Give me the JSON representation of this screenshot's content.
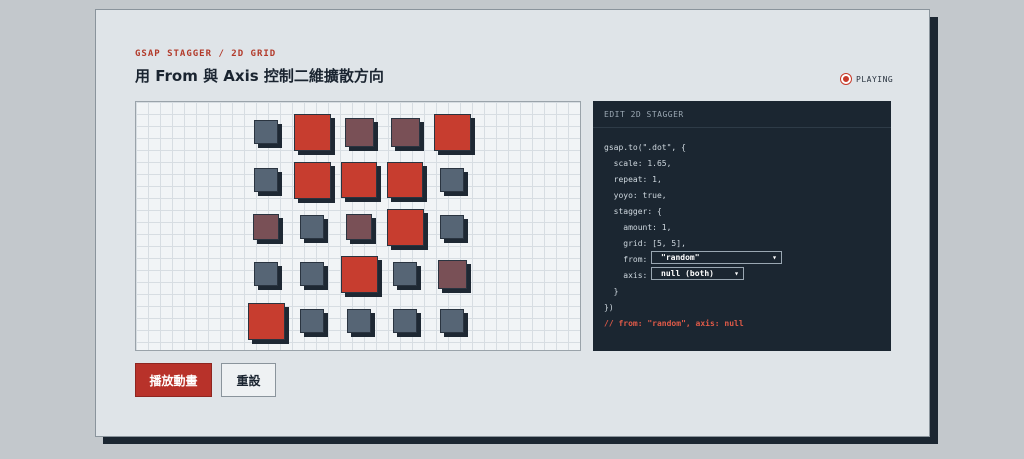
{
  "header": {
    "eyebrow": "GSAP STAGGER / 2D GRID",
    "title": "用 From 與 Axis 控制二維擴散方向",
    "status": "PLAYING"
  },
  "colors": {
    "accent": "#b8322a",
    "red": "#c73d2f",
    "slate": "#566575",
    "mauve": "#795056",
    "dark_panel": "#1b2631"
  },
  "stage": {
    "grid_rows": 5,
    "grid_cols": 5,
    "dots": [
      {
        "row": 0,
        "col": 0,
        "scale": 0.55,
        "color": "slate"
      },
      {
        "row": 0,
        "col": 1,
        "scale": 0.85,
        "color": "red"
      },
      {
        "row": 0,
        "col": 2,
        "scale": 0.65,
        "color": "mauve"
      },
      {
        "row": 0,
        "col": 3,
        "scale": 0.65,
        "color": "mauve"
      },
      {
        "row": 0,
        "col": 4,
        "scale": 0.85,
        "color": "red"
      },
      {
        "row": 1,
        "col": 0,
        "scale": 0.55,
        "color": "slate"
      },
      {
        "row": 1,
        "col": 1,
        "scale": 0.85,
        "color": "red"
      },
      {
        "row": 1,
        "col": 2,
        "scale": 0.82,
        "color": "red"
      },
      {
        "row": 1,
        "col": 3,
        "scale": 0.82,
        "color": "red"
      },
      {
        "row": 1,
        "col": 4,
        "scale": 0.55,
        "color": "slate"
      },
      {
        "row": 2,
        "col": 0,
        "scale": 0.6,
        "color": "mauve"
      },
      {
        "row": 2,
        "col": 1,
        "scale": 0.55,
        "color": "slate"
      },
      {
        "row": 2,
        "col": 2,
        "scale": 0.6,
        "color": "mauve"
      },
      {
        "row": 2,
        "col": 3,
        "scale": 0.85,
        "color": "red"
      },
      {
        "row": 2,
        "col": 4,
        "scale": 0.55,
        "color": "slate"
      },
      {
        "row": 3,
        "col": 0,
        "scale": 0.55,
        "color": "slate"
      },
      {
        "row": 3,
        "col": 1,
        "scale": 0.55,
        "color": "slate"
      },
      {
        "row": 3,
        "col": 2,
        "scale": 0.85,
        "color": "red"
      },
      {
        "row": 3,
        "col": 3,
        "scale": 0.55,
        "color": "slate"
      },
      {
        "row": 3,
        "col": 4,
        "scale": 0.65,
        "color": "mauve"
      },
      {
        "row": 4,
        "col": 0,
        "scale": 0.85,
        "color": "red"
      },
      {
        "row": 4,
        "col": 1,
        "scale": 0.55,
        "color": "slate"
      },
      {
        "row": 4,
        "col": 2,
        "scale": 0.55,
        "color": "slate"
      },
      {
        "row": 4,
        "col": 3,
        "scale": 0.55,
        "color": "slate"
      },
      {
        "row": 4,
        "col": 4,
        "scale": 0.55,
        "color": "slate"
      }
    ]
  },
  "editor": {
    "heading": "EDIT 2D STAGGER",
    "lines": {
      "l1": "gsap.to(\".dot\", {",
      "l2": "  scale: 1.65,",
      "l3": "  repeat: 1,",
      "l4": "  yoyo: true,",
      "l5": "  stagger: {",
      "l6": "    amount: 1,",
      "l7": "    grid: [5, 5],",
      "l8": "    from:",
      "l9": "    axis:",
      "l10": "  }",
      "l11": "})",
      "comment": "// from: \"random\", axis: null"
    },
    "from_select": "\"random\"",
    "axis_select": "null (both)"
  },
  "buttons": {
    "play": "播放動畫",
    "reset": "重設"
  }
}
